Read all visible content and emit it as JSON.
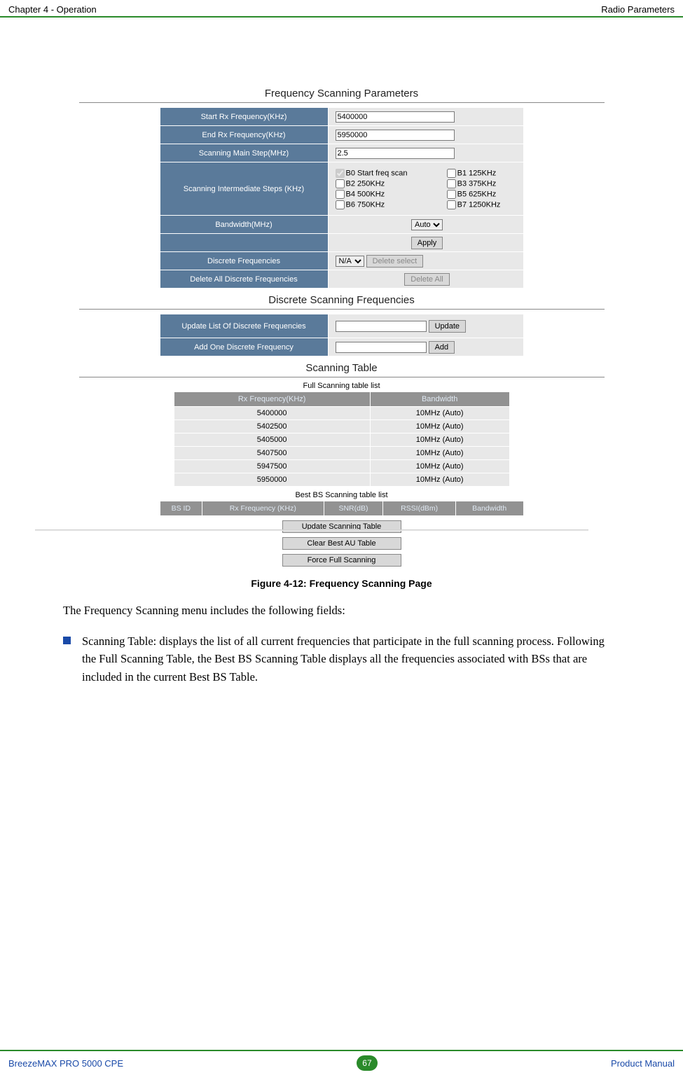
{
  "header": {
    "left": "Chapter 4 - Operation",
    "right": "Radio Parameters"
  },
  "panels": {
    "freq_params": {
      "title": "Frequency Scanning Parameters",
      "rows": {
        "start_rx": {
          "label": "Start Rx Frequency(KHz)",
          "value": "5400000"
        },
        "end_rx": {
          "label": "End Rx Frequency(KHz)",
          "value": "5950000"
        },
        "main_step": {
          "label": "Scanning Main Step(MHz)",
          "value": "2.5"
        },
        "inter_steps": {
          "label": "Scanning Intermediate Steps (KHz)",
          "opts": [
            "B0 Start freq scan",
            "B1 125KHz",
            "B2 250KHz",
            "B3 375KHz",
            "B4 500KHz",
            "B5 625KHz",
            "B6 750KHz",
            "B7 1250KHz"
          ]
        },
        "bandwidth": {
          "label": "Bandwidth(MHz)",
          "selected": "Auto"
        },
        "apply": "Apply",
        "discrete": {
          "label": "Discrete Frequencies",
          "selected": "N/A",
          "btn": "Delete select"
        },
        "delete_all": {
          "label": "Delete All Discrete Frequencies",
          "btn": "Delete All"
        }
      }
    },
    "discrete": {
      "title": "Discrete Scanning Frequencies",
      "update": {
        "label": "Update List Of Discrete Frequencies",
        "btn": "Update"
      },
      "add": {
        "label": "Add One Discrete Frequency",
        "btn": "Add"
      }
    },
    "scanning": {
      "title": "Scanning Table",
      "full_list_caption": "Full Scanning table list",
      "full_cols": [
        "Rx Frequency(KHz)",
        "Bandwidth"
      ],
      "full_rows": [
        [
          "5400000",
          "10MHz (Auto)"
        ],
        [
          "5402500",
          "10MHz (Auto)"
        ],
        [
          "5405000",
          "10MHz (Auto)"
        ],
        [
          "5407500",
          "10MHz (Auto)"
        ],
        [
          "5947500",
          "10MHz (Auto)"
        ],
        [
          "5950000",
          "10MHz (Auto)"
        ]
      ],
      "best_caption": "Best BS Scanning table list",
      "best_cols": [
        "BS ID",
        "Rx Frequency (KHz)",
        "SNR(dB)",
        "RSSI(dBm)",
        "Bandwidth"
      ],
      "buttons": [
        "Update Scanning Table",
        "Clear Best AU Table",
        "Force Full Scanning"
      ]
    }
  },
  "figure_caption": "Figure 4-12: Frequency Scanning Page",
  "body": {
    "intro": "The Frequency Scanning menu includes the following fields:",
    "bullet": "Scanning Table: displays the list of all current frequencies that participate in the full scanning process. Following the Full Scanning Table, the Best BS Scanning Table displays all the frequencies associated with BSs that are included in the current Best BS Table."
  },
  "footer": {
    "left": "BreezeMAX PRO 5000 CPE",
    "page": "67",
    "right": "Product Manual"
  }
}
